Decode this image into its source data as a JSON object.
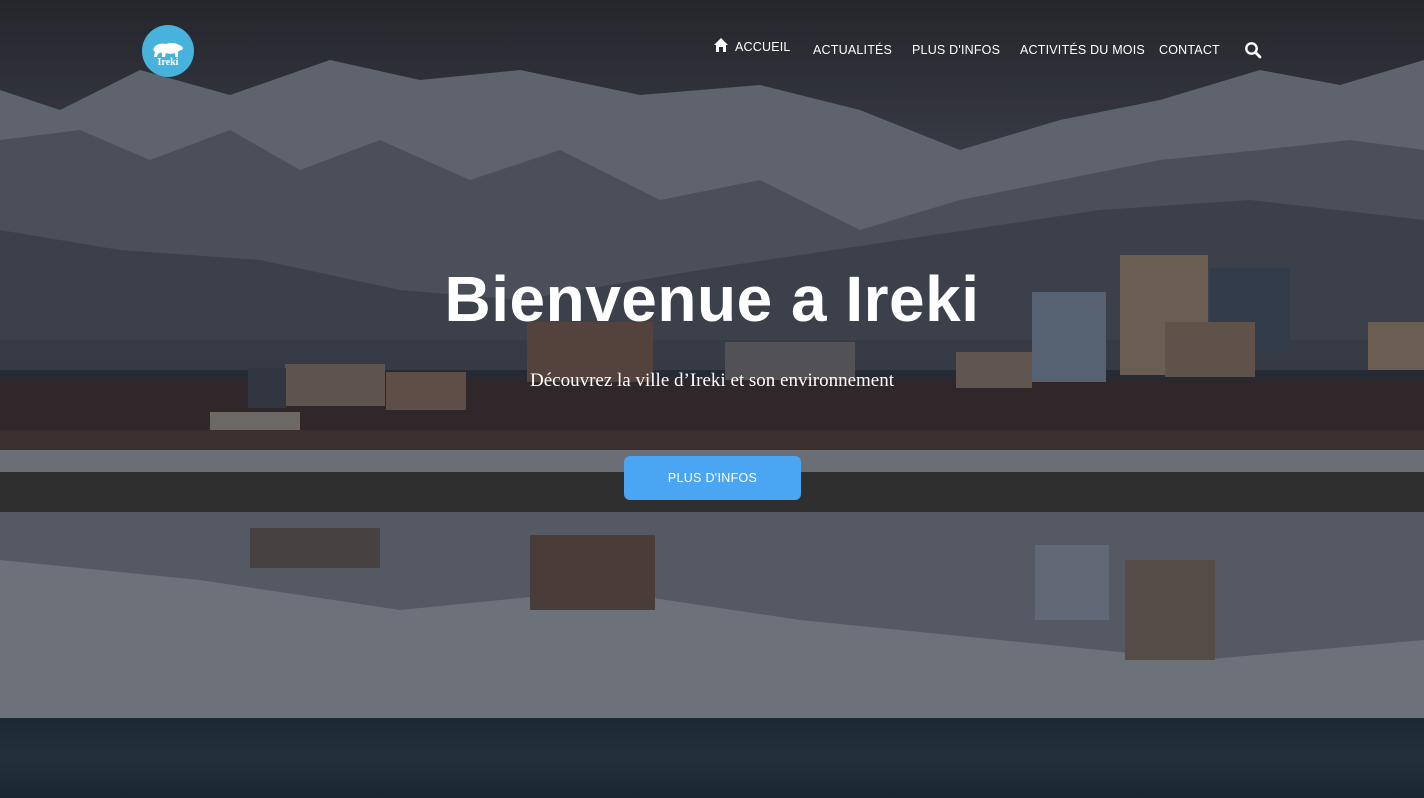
{
  "brand": {
    "logo_text": "Ireki",
    "logo_color": "#47b3dd"
  },
  "nav": {
    "items": [
      {
        "label": "ACCUEIL",
        "icon": "home-icon"
      },
      {
        "label": "ACTUALITÉS"
      },
      {
        "label": "PLUS D'INFOS"
      },
      {
        "label": "ACTIVITÉS DU MOIS"
      },
      {
        "label": "CONTACT"
      }
    ],
    "search_icon": "search-icon"
  },
  "hero": {
    "title": "Bienvenue a Ireki",
    "subtitle": "Découvrez la ville d’Ireki et son environnement",
    "cta_label": "PLUS D'INFOS",
    "cta_color": "#4aa6f2"
  }
}
